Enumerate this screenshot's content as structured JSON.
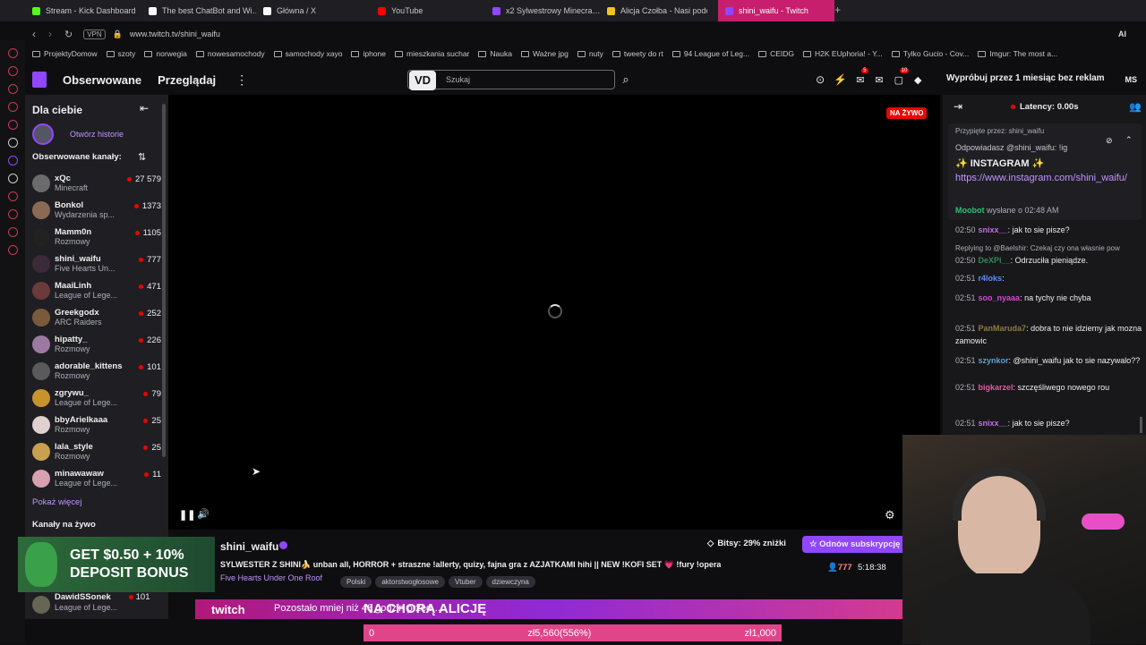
{
  "browser": {
    "tabs": [
      {
        "label": "Stream - Kick Dashboard",
        "color": "#53fc18"
      },
      {
        "label": "The best ChatBot and Wi…",
        "color": "#ffffff"
      },
      {
        "label": "Główna / X",
        "color": "#ffffff"
      },
      {
        "label": "YouTube",
        "color": "#ff0000"
      },
      {
        "label": "x2 Sylwestrowy Minecra…",
        "color": "#9146ff"
      },
      {
        "label": "Alicja Czołba - Nasi podop…",
        "color": "#f0c419"
      },
      {
        "label": "shini_waifu - Twitch",
        "color": "#9146ff"
      }
    ],
    "vpn_label": "VPN",
    "url": "www.twitch.tv/shini_waifu",
    "ai_label": "AI",
    "bookmarks": [
      "ProjektyDomow",
      "szoty",
      "norwegia",
      "nowesamochody",
      "samochody xayo",
      "iphone",
      "mieszkania suchar",
      "Nauka",
      "Ważne jpg",
      "nuty",
      "tweety do rt",
      "94 League of Leg...",
      "CEIDG",
      "H2K EUphoria! - Y...",
      "Tylko Gucio - Cov...",
      "Imgur: The most a..."
    ]
  },
  "twitch": {
    "nav": {
      "following": "Obserwowane",
      "browse": "Przeglądaj",
      "search_placeholder": "Szukaj",
      "promo": "Wypróbuj przez 1 miesiąc bez reklam",
      "badge_notifications": "5",
      "badge_inbox": "10",
      "avatar_initials": "MS"
    },
    "sidebar": {
      "title": "Dla ciebie",
      "stories": "Otwórz historie",
      "followed_title": "Obserwowane kanały:",
      "channels": [
        {
          "name": "xQc",
          "game": "Minecraft",
          "viewers": "27 579",
          "color": "#6b6b6b"
        },
        {
          "name": "Bonkol",
          "game": "Wydarzenia sp...",
          "viewers": "1373",
          "color": "#8a6a55"
        },
        {
          "name": "Mamm0n",
          "game": "Rozmowy",
          "viewers": "1105",
          "color": "#222222"
        },
        {
          "name": "shini_waifu",
          "game": "Five Hearts Un...",
          "viewers": "777",
          "color": "#3a2a3a"
        },
        {
          "name": "MaaiLinh",
          "game": "League of Lege...",
          "viewers": "471",
          "color": "#6a3b3b"
        },
        {
          "name": "Greekgodx",
          "game": "ARC Raiders",
          "viewers": "252",
          "color": "#7a5a3a"
        },
        {
          "name": "hipatty_",
          "game": "Rozmowy",
          "viewers": "226",
          "color": "#9a7aa0"
        },
        {
          "name": "adorable_kittens",
          "game": "Rozmowy",
          "viewers": "101",
          "color": "#5a5a5a"
        },
        {
          "name": "zgrywu_",
          "game": "League of Lege...",
          "viewers": "79",
          "color": "#c8932a"
        },
        {
          "name": "bbyArielkaaa",
          "game": "Rozmowy",
          "viewers": "25",
          "color": "#e0d0d0"
        },
        {
          "name": "lala_style",
          "game": "Rozmowy",
          "viewers": "25",
          "color": "#c8a050"
        },
        {
          "name": "minawawaw",
          "game": "League of Lege...",
          "viewers": "11",
          "color": "#d8a0b0"
        }
      ],
      "show_more": "Pokaż więcej",
      "live_title": "Kanały na żywo",
      "extra_channel": {
        "name": "DawidSSonek",
        "game": "League of Lege...",
        "viewers": "101"
      }
    },
    "player": {
      "live_label": "NA ŻYWO"
    },
    "stream": {
      "channel": "shini_waifu",
      "title": "SYLWESTER Z SHINI🍌 unban all, HORROR + straszne !allerty, quizy, fajna gra z AZJATKAMI hihi || NEW !KOFI SET 💗 !fury !opera",
      "game": "Five Hearts Under One Roof",
      "tags": [
        "Polski",
        "aktorstwogłosowe",
        "Vtuber",
        "dziewczyna"
      ],
      "bits": "Bitsy: 29% zniżki",
      "subscribe": "Odnów subskrypcję",
      "viewers": "777",
      "uptime": "5:18:38"
    },
    "chat": {
      "latency": "Latency: 0.00s",
      "pinned_by": "Przypięte przez:",
      "pinned_user": "shini_waifu",
      "reply_to": "Odpowiadasz @shini_waifu: !ig",
      "pinned_text": "✨ INSTAGRAM ✨",
      "pinned_link": "https://www.instagram.com/shini_waifu/",
      "moobot": "Moobot",
      "sent_at": "wysłane o 02:48 AM",
      "messages": [
        {
          "time": "02:50",
          "user": "snixx__",
          "text": ": jak to sie pisze?",
          "color": "#c070e0"
        },
        {
          "time": "",
          "user": "",
          "text": "Replying to @Baelshir: Czekaj czy ona własnie pow",
          "color": "#adadb8"
        },
        {
          "time": "02:50",
          "user": "DeXPi__",
          "text": ": Odrzuciła pieniądze.",
          "color": "#2e8b57"
        },
        {
          "time": "02:51",
          "user": "r4loks",
          "text": ":",
          "color": "#5a8ef5"
        },
        {
          "time": "02:51",
          "user": "soo_nyaaa",
          "text": ": na tychy nie chyba",
          "color": "#d04bd0"
        },
        {
          "time": "02:51",
          "user": "PanMaruda7",
          "text": ": dobra to nie idziemy jak mozna zamowic",
          "color": "#8b7d3a"
        },
        {
          "time": "02:51",
          "user": "szynkor",
          "text": ": @shini_waifu jak to sie nazywalo??",
          "color": "#5fa0d0"
        },
        {
          "time": "02:51",
          "user": "bigkarzel",
          "text": ": szczęśliwego nowego rou",
          "color": "#e05aa0"
        },
        {
          "time": "02:51",
          "user": "snixx__",
          "text": ": jak to sie pisze?",
          "color": "#c070e0"
        }
      ]
    }
  },
  "overlays": {
    "ad_line1": "GET $0.50 + 10%",
    "ad_line2": "DEPOSIT BONUS",
    "donation_brand": "twitch",
    "donation_text": "Pozostało mniej niż 48 godzin przed …",
    "donation_title": "NA CHORĄ ALICJĘ",
    "goal_start": "0",
    "goal_current": "zł5,560(556%)",
    "goal_end": "zł1,000"
  }
}
